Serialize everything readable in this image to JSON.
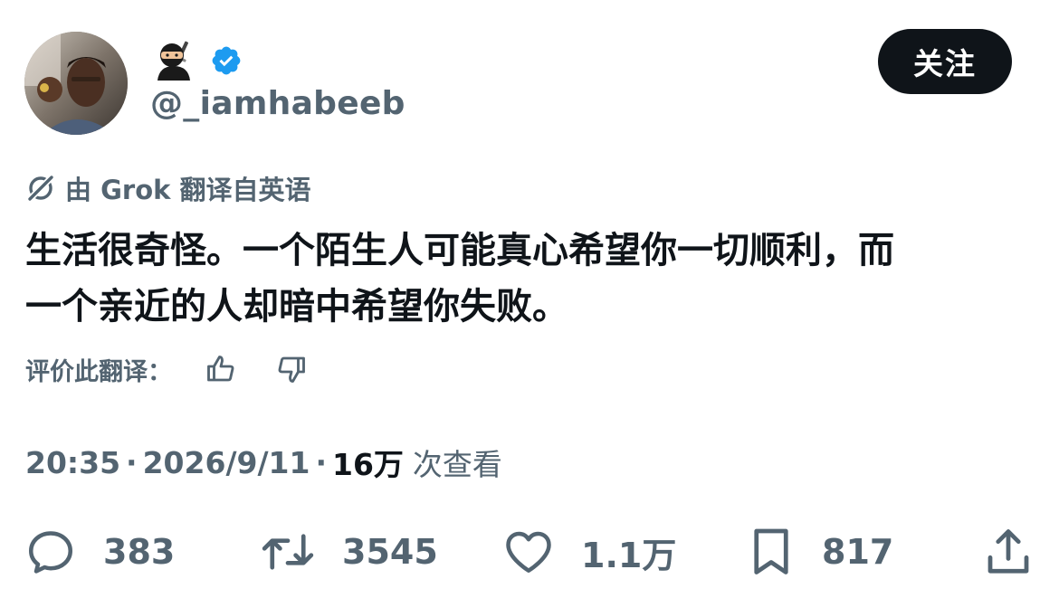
{
  "author": {
    "display_name_icons": [
      "ninja-emoji",
      "verified-badge"
    ],
    "handle": "@_iamhabeeb",
    "avatar": "profile-photo"
  },
  "follow_button": {
    "label": "关注"
  },
  "translation": {
    "icon": "grok-icon",
    "label": "由 Grok 翻译自英语"
  },
  "tweet": {
    "text_line1": "生活很奇怪。一个陌生人可能真心希望你一切顺利，而",
    "text_line2": "一个亲近的人却暗中希望你失败。"
  },
  "rating": {
    "label": "评价此翻译：",
    "icons": [
      "thumbs-up-icon",
      "thumbs-down-icon"
    ]
  },
  "meta": {
    "time": "20:35",
    "separator": "·",
    "date": "2026/9/11",
    "views_count": "16万",
    "views_label": "次查看"
  },
  "actions": {
    "replies": "383",
    "reposts": "3545",
    "likes": "1.1万",
    "bookmarks": "817"
  },
  "colors": {
    "text_primary": "#0f1419",
    "text_secondary": "#536471",
    "verified_blue": "#1d9bf0",
    "button_bg": "#0f1419",
    "background": "#ffffff"
  }
}
